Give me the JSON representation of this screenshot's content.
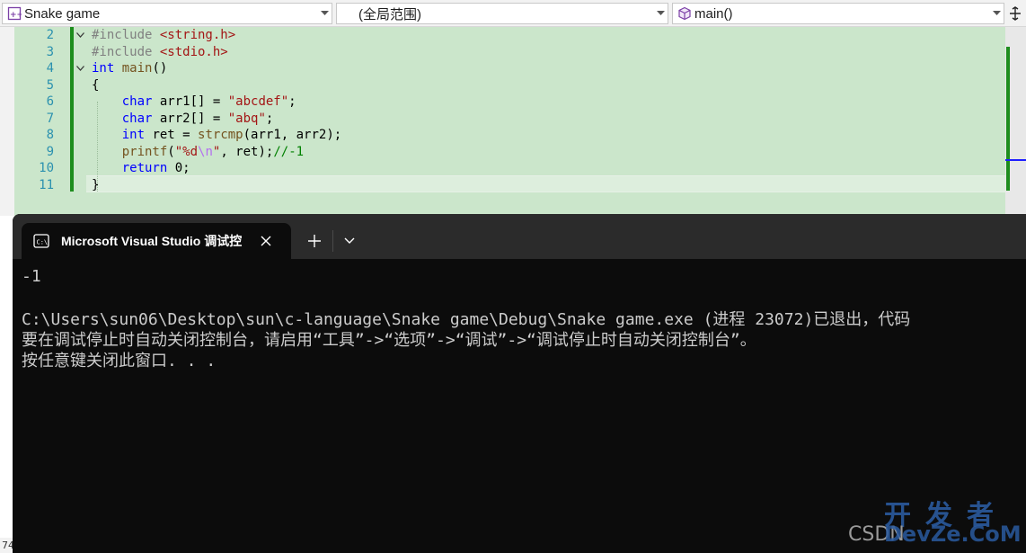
{
  "navbar": {
    "project": "Snake game",
    "scope": "(全局范围)",
    "member": "main()"
  },
  "editor": {
    "lines": [
      {
        "num": "2",
        "parts": [
          {
            "t": "#include ",
            "c": "pp"
          },
          {
            "t": "<string.h>",
            "c": "hdr"
          }
        ]
      },
      {
        "num": "3",
        "parts": [
          {
            "t": "#include ",
            "c": "pp"
          },
          {
            "t": "<stdio.h>",
            "c": "hdr"
          }
        ]
      },
      {
        "num": "4",
        "parts": [
          {
            "t": "int",
            "c": "kw"
          },
          {
            "t": " ",
            "c": ""
          },
          {
            "t": "main",
            "c": "fn"
          },
          {
            "t": "()",
            "c": ""
          }
        ]
      },
      {
        "num": "5",
        "parts": [
          {
            "t": "{",
            "c": ""
          }
        ]
      },
      {
        "num": "6",
        "parts": [
          {
            "t": "    ",
            "c": ""
          },
          {
            "t": "char",
            "c": "kw"
          },
          {
            "t": " arr1[] = ",
            "c": ""
          },
          {
            "t": "\"abcdef\"",
            "c": "str"
          },
          {
            "t": ";",
            "c": ""
          }
        ]
      },
      {
        "num": "7",
        "parts": [
          {
            "t": "    ",
            "c": ""
          },
          {
            "t": "char",
            "c": "kw"
          },
          {
            "t": " arr2[] = ",
            "c": ""
          },
          {
            "t": "\"abq\"",
            "c": "str"
          },
          {
            "t": ";",
            "c": ""
          }
        ]
      },
      {
        "num": "8",
        "parts": [
          {
            "t": "    ",
            "c": ""
          },
          {
            "t": "int",
            "c": "kw"
          },
          {
            "t": " ret = ",
            "c": ""
          },
          {
            "t": "strcmp",
            "c": "fn"
          },
          {
            "t": "(arr1, arr2);",
            "c": ""
          }
        ]
      },
      {
        "num": "9",
        "parts": [
          {
            "t": "    ",
            "c": ""
          },
          {
            "t": "printf",
            "c": "fn"
          },
          {
            "t": "(",
            "c": ""
          },
          {
            "t": "\"%d",
            "c": "str"
          },
          {
            "t": "\\n",
            "c": "esc"
          },
          {
            "t": "\"",
            "c": "str"
          },
          {
            "t": ", ret);",
            "c": ""
          },
          {
            "t": "//-1",
            "c": "cm"
          }
        ]
      },
      {
        "num": "10",
        "parts": [
          {
            "t": "    ",
            "c": ""
          },
          {
            "t": "return",
            "c": "kw"
          },
          {
            "t": " 0;",
            "c": ""
          }
        ]
      },
      {
        "num": "11",
        "parts": [
          {
            "t": "}",
            "c": ""
          }
        ]
      }
    ],
    "status_left": "74"
  },
  "terminal": {
    "tab_title": "Microsoft Visual Studio 调试控",
    "output": [
      "-1",
      "",
      "C:\\Users\\sun06\\Desktop\\sun\\c-language\\Snake game\\Debug\\Snake game.exe (进程 23072)已退出，代码",
      "要在调试停止时自动关闭控制台，请启用“工具”->“选项”->“调试”->“调试停止时自动关闭控制台”。",
      "按任意键关闭此窗口. . ."
    ]
  },
  "watermark": {
    "cn": "开发者",
    "csdn": "CSDN",
    "en": "DevZe.CoM"
  },
  "colors": {
    "editor_bg": "#cbe6cb",
    "change_bar": "#1d8d1d",
    "terminal_bg": "#0c0c0c",
    "console_text": "#cccccc"
  }
}
